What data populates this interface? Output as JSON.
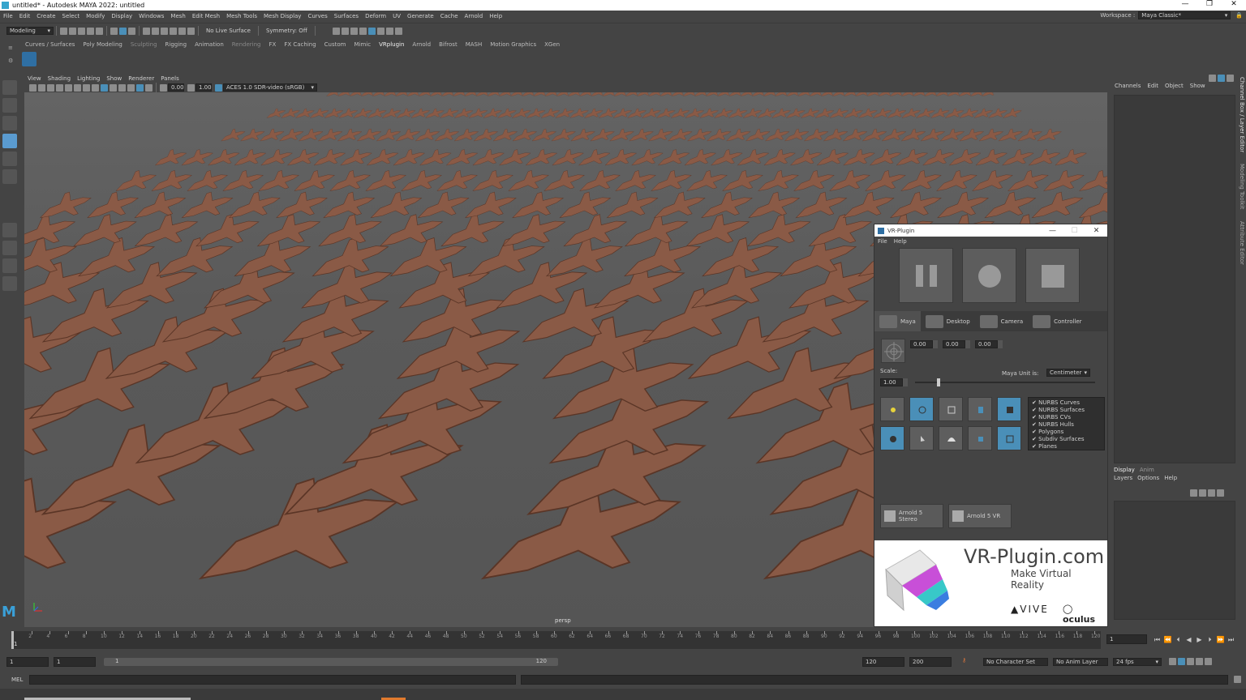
{
  "window": {
    "title": "untitled* - Autodesk MAYA 2022: untitled",
    "controls": [
      "—",
      "❐",
      "✕"
    ]
  },
  "menubar": [
    "File",
    "Edit",
    "Create",
    "Select",
    "Modify",
    "Display",
    "Windows",
    "Mesh",
    "Edit Mesh",
    "Mesh Tools",
    "Mesh Display",
    "Curves",
    "Surfaces",
    "Deform",
    "UV",
    "Generate",
    "Cache",
    "Arnold",
    "Help"
  ],
  "workspace": {
    "label": "Workspace :",
    "value": "Maya Classic*"
  },
  "statusline": {
    "menuset": "Modeling",
    "live_surface": "No Live Surface",
    "symmetry": "Symmetry: Off"
  },
  "shelf_tabs": [
    "Curves / Surfaces",
    "Poly Modeling",
    "Sculpting",
    "Rigging",
    "Animation",
    "Rendering",
    "FX",
    "FX Caching",
    "Custom",
    "Mimic",
    "VRplugin",
    "Arnold",
    "Bifrost",
    "MASH",
    "Motion Graphics",
    "XGen"
  ],
  "viewport": {
    "menu": [
      "View",
      "Shading",
      "Lighting",
      "Show",
      "Renderer",
      "Panels"
    ],
    "exposure": "0.00",
    "gamma": "1.00",
    "colorspace": "ACES 1.0 SDR-video (sRGB)",
    "camera_label": "persp"
  },
  "vrplugin": {
    "title": "VR-Plugin",
    "menu": [
      "File",
      "Help"
    ],
    "tabs": [
      "Maya",
      "Desktop",
      "Camera",
      "Controller"
    ],
    "offsets": [
      "0.00",
      "0.00",
      "0.00"
    ],
    "scale_label": "Scale:",
    "scale_value": "1.00",
    "scale_slider": 0.12,
    "unit_label": "Maya Unit is:",
    "unit_value": "Centimeter",
    "object_filters": [
      "NURBS Curves",
      "NURBS Surfaces",
      "NURBS CVs",
      "NURBS Hulls",
      "Polygons",
      "Subdiv Surfaces",
      "Planes"
    ],
    "arnold_buttons": [
      "Arnold 5 Stereo",
      "Arnold 5 VR"
    ],
    "banner": {
      "site": "VR-Plugin.com",
      "tagline": "Make Virtual Reality",
      "brand1": "VIVE",
      "brand2": "oculus"
    }
  },
  "channelbox": {
    "menu": [
      "Channels",
      "Edit",
      "Object",
      "Show"
    ]
  },
  "layer_editor": {
    "tabs": [
      "Display",
      "Anim"
    ],
    "menu": [
      "Layers",
      "Options",
      "Help"
    ]
  },
  "side_tabs": [
    "Channel Box / Layer Editor",
    "Modeling Toolkit",
    "Attribute Editor"
  ],
  "timeslider": {
    "ticks": [
      "2",
      "4",
      "6",
      "8",
      "10",
      "12",
      "14",
      "16",
      "18",
      "20",
      "22",
      "24",
      "26",
      "28",
      "30",
      "32",
      "34",
      "36",
      "38",
      "40",
      "42",
      "44",
      "46",
      "48",
      "50",
      "52",
      "54",
      "56",
      "58",
      "60",
      "62",
      "64",
      "66",
      "68",
      "70",
      "72",
      "74",
      "76",
      "78",
      "80",
      "82",
      "84",
      "86",
      "88",
      "90",
      "92",
      "94",
      "96",
      "98",
      "100",
      "102",
      "104",
      "106",
      "108",
      "110",
      "112",
      "114",
      "116",
      "118",
      "120"
    ],
    "current_frame": "1",
    "current_field": "1"
  },
  "range": {
    "start": "1",
    "playback_start": "1",
    "slider_start": "1",
    "slider_end": "120",
    "playback_end": "120",
    "end": "200",
    "character_set": "No Character Set",
    "anim_layer": "No Anim Layer",
    "fps": "24 fps"
  },
  "cmdline": {
    "label": "MEL"
  },
  "colors": {
    "accent": "#4a8fb8",
    "plane_color": "#8a5a46"
  }
}
